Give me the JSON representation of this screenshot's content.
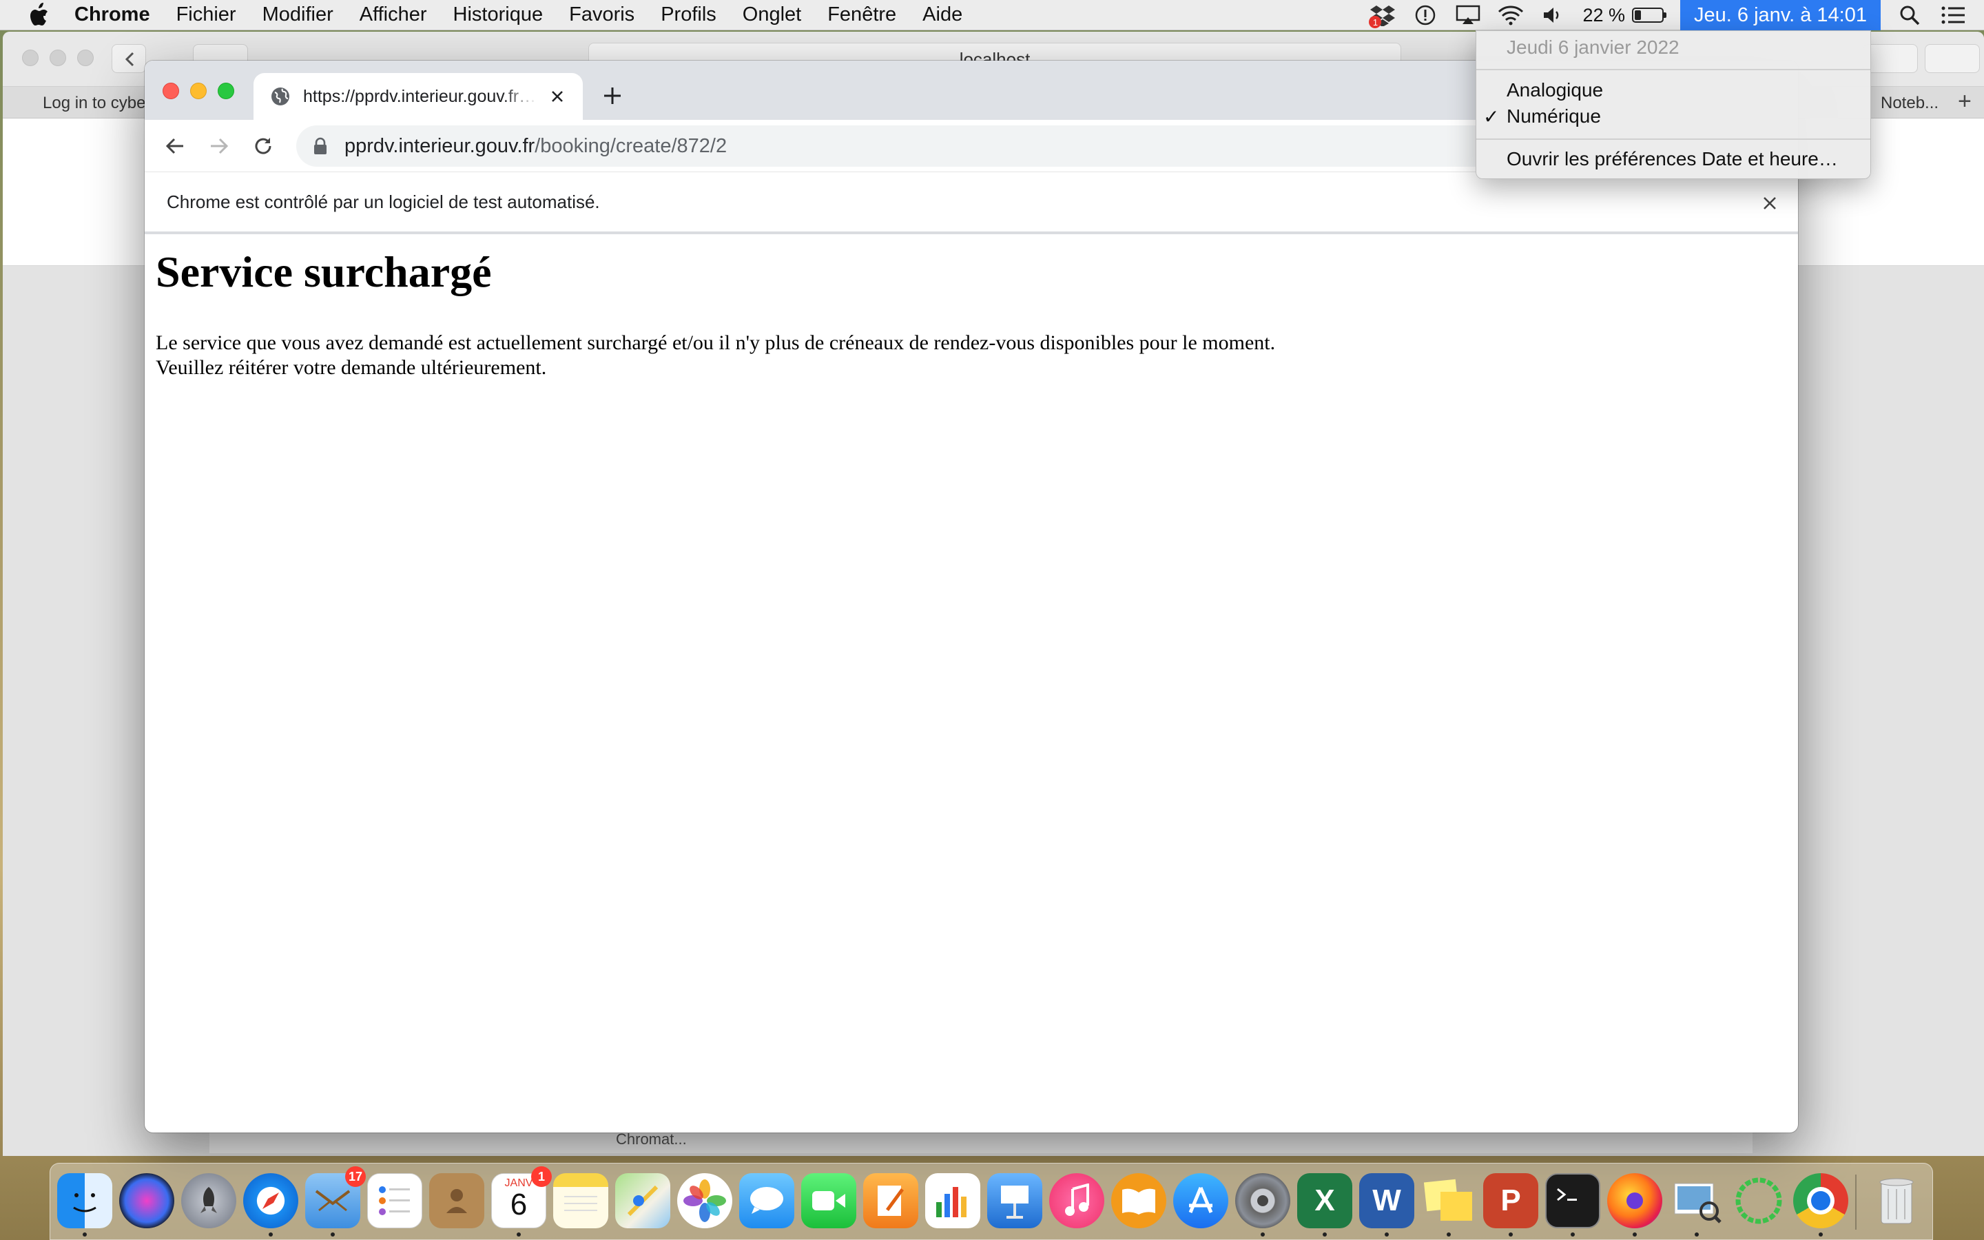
{
  "menubar": {
    "app_name": "Chrome",
    "menus": [
      "Fichier",
      "Modifier",
      "Afficher",
      "Historique",
      "Favoris",
      "Profils",
      "Onglet",
      "Fenêtre",
      "Aide"
    ],
    "battery_text": "22 %",
    "battery_level": 0.22,
    "clock": "Jeu. 6 janv. à  14:01",
    "dropbox_badge": "1"
  },
  "date_menu": {
    "date_label": "Jeudi 6 janvier 2022",
    "analog": "Analogique",
    "digital": "Numérique",
    "checkmark": "✓",
    "preferences": "Ouvrir les préférences Date et heure…"
  },
  "background_window": {
    "address": "localhost",
    "tab_left": "Log in to cybe",
    "tab_right": "Noteb...",
    "tab_plus": "+",
    "bottom_text": "Chromat..."
  },
  "chrome": {
    "tab_title": "https://pprdv.interieur.gouv.fr/booking/create/872/2",
    "url_host": "pprdv.interieur.gouv.fr",
    "url_path": "/booking/create/872/2",
    "infobar_text": "Chrome est contrôlé par un logiciel de test automatisé."
  },
  "page": {
    "title": "Service surchargé",
    "line1": "Le service que vous avez demandé est actuellement surchargé et/ou il n'y plus de créneaux de rendez-vous disponibles pour le moment.",
    "line2": "Veuillez réitérer votre demande ultérieurement."
  },
  "dock": {
    "mail_badge": "17",
    "calendar_month": "JANV",
    "calendar_day": "6",
    "calendar_badge": "1",
    "apps": [
      "Finder",
      "Siri",
      "Launchpad",
      "Safari",
      "Mail",
      "Rappels",
      "Contacts",
      "Calendrier",
      "Notes",
      "Plans",
      "Photos",
      "Messages",
      "FaceTime",
      "Pages",
      "Numbers",
      "Keynote",
      "Musique",
      "Livres",
      "App Store",
      "Préférences Système",
      "Excel",
      "Word",
      "Stickies",
      "PowerPoint",
      "Terminal",
      "Firefox",
      "Aperçu",
      "Activité",
      "Chrome",
      "Corbeille"
    ],
    "colors": {
      "accent": "#2c7bf2",
      "close": "#fe5f57",
      "minimize": "#febc2e",
      "zoom": "#28c840"
    }
  }
}
